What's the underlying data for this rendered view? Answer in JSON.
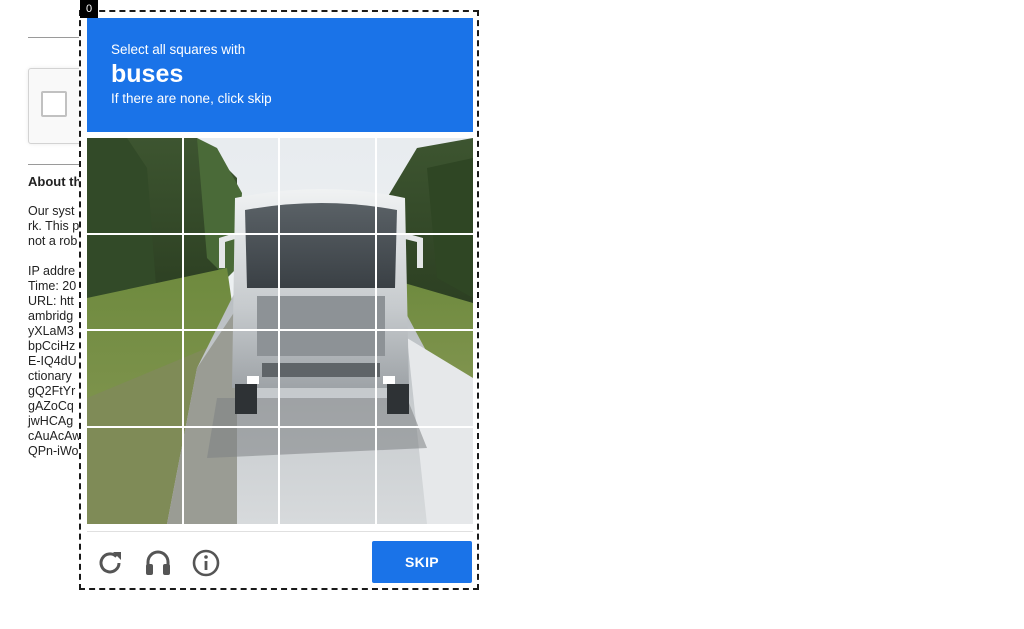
{
  "frame_badge": "0",
  "background_page": {
    "about_heading": "About th",
    "text_lines": [
      "Our syst",
      "rk. This p",
      "not a rob",
      "",
      "IP addre",
      "Time: 20",
      "URL: htt",
      "ambridg",
      "yXLaM3",
      "bpCciHz",
      "E-IQ4dU",
      "ctionary",
      "gQ2FtYr",
      "gAZoCq",
      "jwHCAg",
      "cAuAcAw",
      "QPn-iWo"
    ]
  },
  "challenge": {
    "instruction_prefix": "Select all squares with",
    "target_object": "buses",
    "instruction_suffix": "If there are none, click skip",
    "grid_rows": 4,
    "grid_cols": 4,
    "reload_icon": "reload-icon",
    "audio_icon": "headphones-icon",
    "info_icon": "info-icon",
    "skip_label": "SKIP",
    "colors": {
      "accent": "#1a73e8",
      "header_text": "#ffffff",
      "control_icon": "#555555"
    }
  }
}
